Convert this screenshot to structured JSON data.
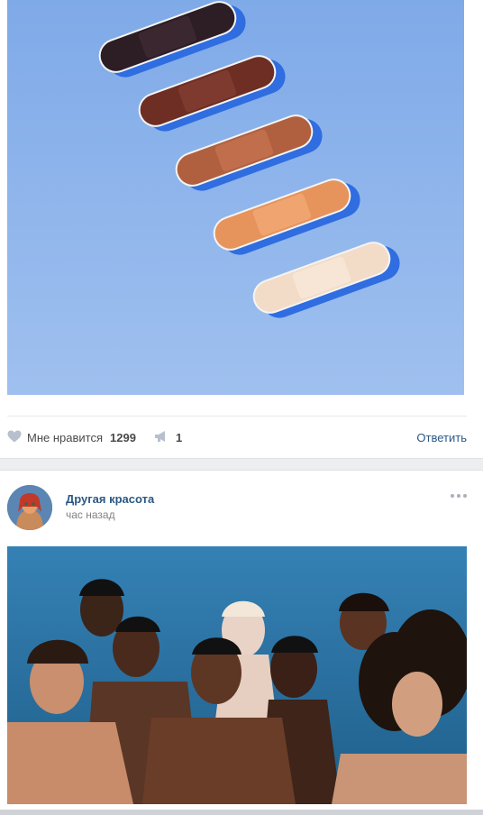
{
  "post1": {
    "likes_label": "Мне нравится",
    "likes_count": "1299",
    "reposts_count": "1",
    "reply_label": "Ответить"
  },
  "post2": {
    "author": "Другая красота",
    "time": "час назад"
  },
  "icons": {
    "like": "heart-icon",
    "share": "megaphone-icon",
    "more": "more-dots-icon"
  },
  "colors": {
    "link": "#2a5885",
    "muted": "#828282",
    "page_separator": "#edeef0",
    "photo1_background": "#8fb4ea"
  }
}
